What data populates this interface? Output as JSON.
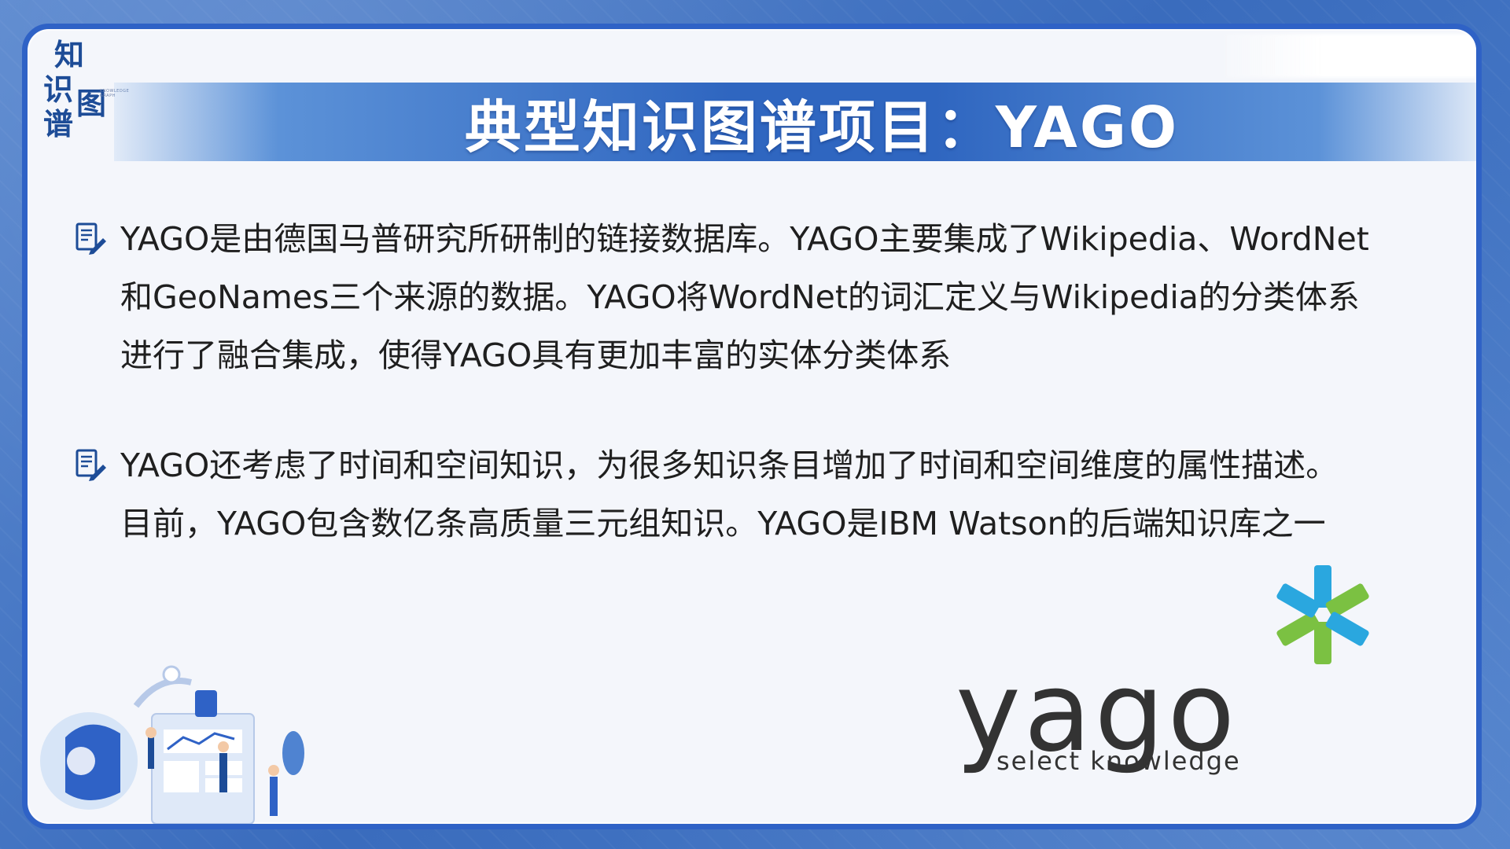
{
  "logo": {
    "chars": [
      "知",
      "识",
      "图",
      "谱"
    ],
    "subtitle": "KNOWLEDGE GRAPH"
  },
  "slide": {
    "title": "典型知识图谱项目：YAGO"
  },
  "bullets": [
    {
      "icon": "document-pencil-icon",
      "lines": [
        "YAGO是由德国马普研究所研制的链接数据库。YAGO主要集成了Wikipedia、WordNet",
        "和GeoNames三个来源的数据。YAGO将WordNet的词汇定义与Wikipedia的分类体系",
        "进行了融合集成，使得YAGO具有更加丰富的实体分类体系"
      ]
    },
    {
      "icon": "document-pencil-icon",
      "lines": [
        "YAGO还考虑了时间和空间知识，为很多知识条目增加了时间和空间维度的属性描述。",
        "目前，YAGO包含数亿条高质量三元组知识。YAGO是IBM Watson的后端知识库之一"
      ]
    }
  ],
  "yago_logo": {
    "word": "yago",
    "tagline": "select knowledge",
    "colors": {
      "green": "#7bc142",
      "blue": "#2aa7df",
      "text": "#333333"
    }
  },
  "theme": {
    "frame": "#2f62c6",
    "title_band": "#2f66c0",
    "background": "#f4f6fb"
  }
}
